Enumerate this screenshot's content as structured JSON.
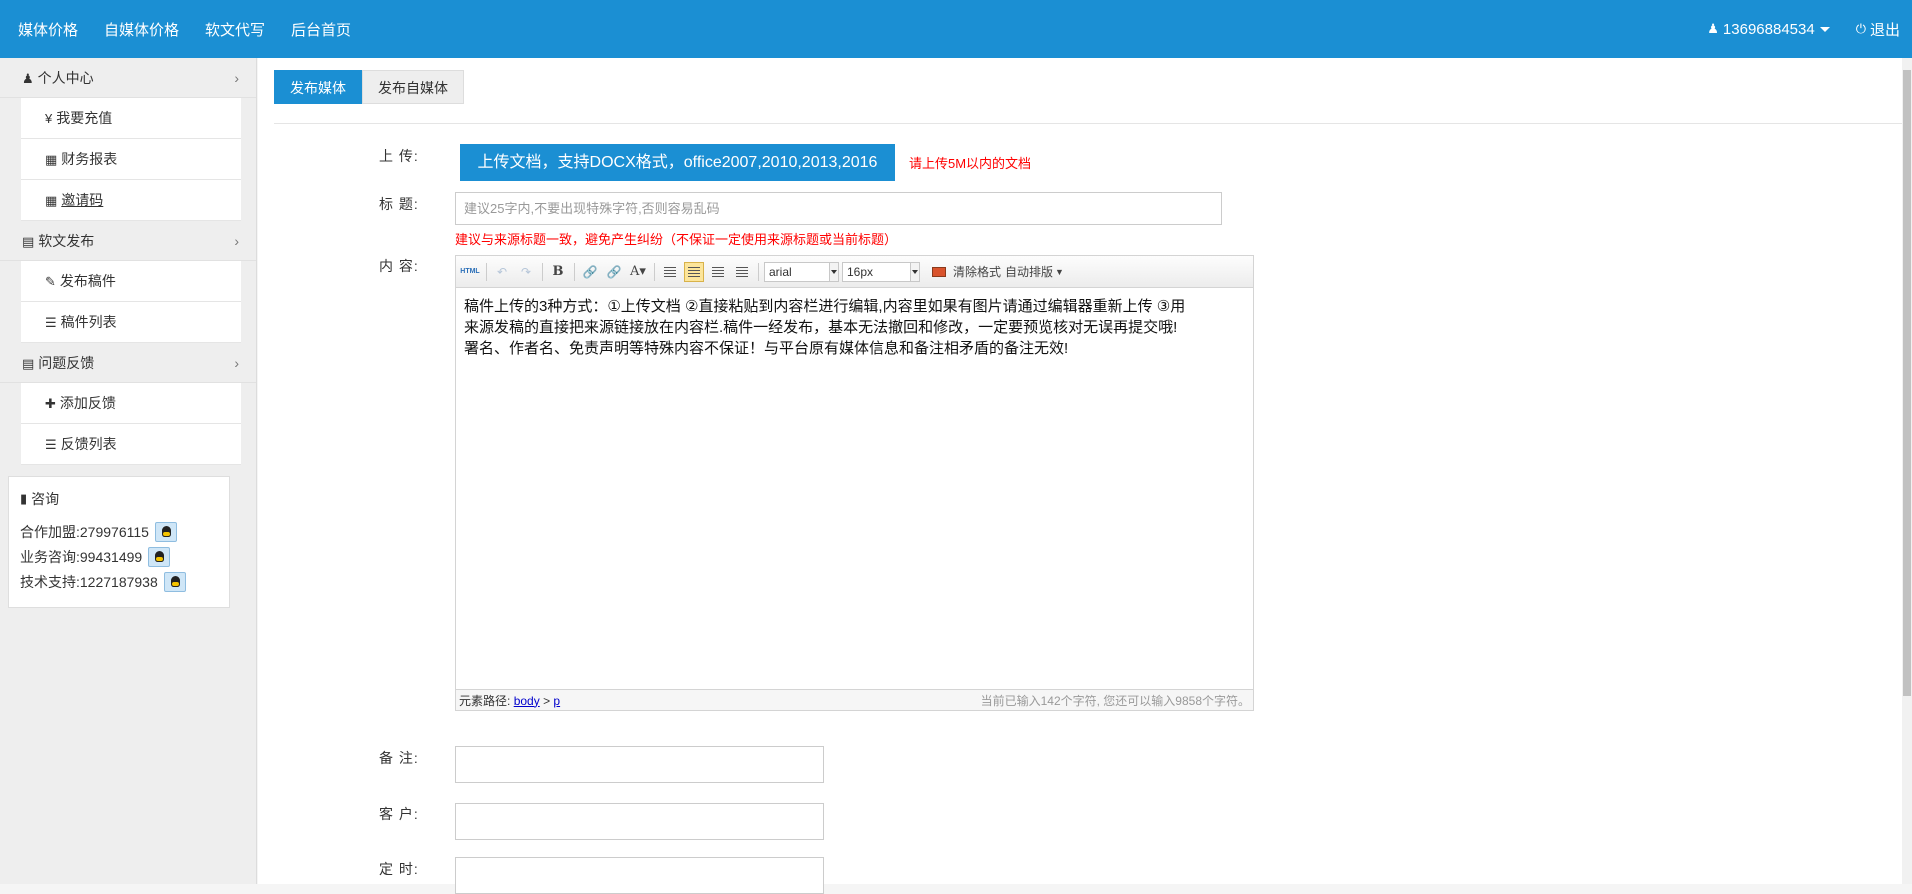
{
  "topnav": {
    "items": [
      "媒体价格",
      "自媒体价格",
      "软文代写",
      "后台首页"
    ],
    "user": "13696884534",
    "logout": "退出"
  },
  "sidebar": {
    "group1": "个人中心",
    "group1_items": [
      "我要充值",
      "财务报表",
      "邀请码"
    ],
    "group2": "软文发布",
    "group2_items": [
      "发布稿件",
      "稿件列表"
    ],
    "group3": "问题反馈",
    "group3_items": [
      "添加反馈",
      "反馈列表"
    ],
    "recharge_symbol": "¥"
  },
  "consult": {
    "title": "咨询",
    "rows": [
      "合作加盟:279976115",
      "业务咨询:99431499",
      "技术支持:1227187938"
    ]
  },
  "tabs": [
    "发布媒体",
    "发布自媒体"
  ],
  "form": {
    "upload_label": "上 传:",
    "upload_button": "上传文档，支持DOCX格式，office2007,2010,2013,2016",
    "upload_hint": "请上传5M以内的文档",
    "title_label": "标 题:",
    "title_placeholder": "建议25字内,不要出现特殊字符,否则容易乱码",
    "title_hint": "建议与来源标题一致，避免产生纠纷（不保证一定使用来源标题或当前标题）",
    "content_label": "内 容:",
    "remark_label": "备 注:",
    "client_label": "客 户:",
    "timer_label": "定 时:"
  },
  "editor": {
    "html_btn": "HTML",
    "font": "arial",
    "size": "16px",
    "clear_format": "清除格式",
    "auto_layout": "自动排版",
    "content_lines": [
      "稿件上传的3种方式：①上传文档 ②直接粘贴到内容栏进行编辑,内容里如果有图片请通过编辑器重新上传  ③用",
      "来源发稿的直接把来源链接放在内容栏.稿件一经发布，基本无法撤回和修改，一定要预览核对无误再提交哦!",
      "署名、作者名、免责声明等特殊内容不保证！与平台原有媒体信息和备注相矛盾的备注无效!"
    ],
    "path_label": "元素路径:",
    "path_body": "body",
    "path_sep": ">",
    "path_p": "p",
    "counter": "当前已输入142个字符, 您还可以输入9858个字符。"
  },
  "colors": {
    "primary": "#1b8fd3",
    "warning": "#ff0000"
  }
}
